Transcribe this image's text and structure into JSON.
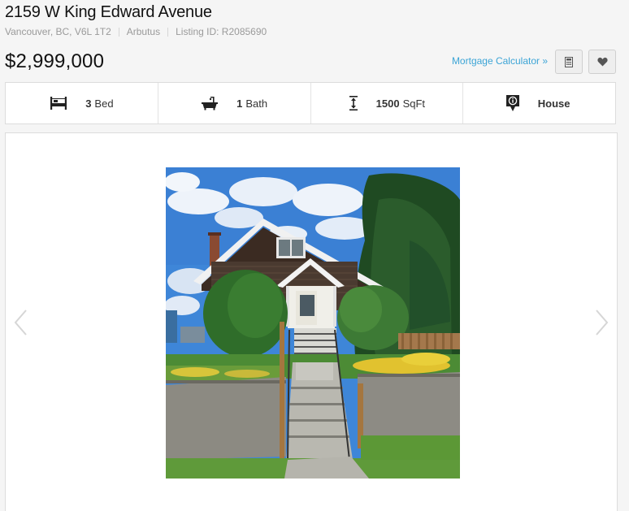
{
  "listing": {
    "title": "2159 W King Edward Avenue",
    "location": "Vancouver, BC, V6L 1T2",
    "neighborhood": "Arbutus",
    "listing_id": "Listing ID: R2085690",
    "price": "$2,999,000"
  },
  "toolbar": {
    "mortgage_label": "Mortgage Calculator »",
    "calculator_icon": "calculator-icon",
    "favorite_icon": "heart-icon"
  },
  "facts": {
    "beds_value": "3",
    "beds_unit": "Bed",
    "baths_value": "1",
    "baths_unit": "Bath",
    "area_value": "1500",
    "area_unit": "SqFt",
    "type_label": "House"
  },
  "gallery": {
    "prev_icon": "chevron-left-icon",
    "next_icon": "chevron-right-icon"
  },
  "colors": {
    "link": "#3ba4d6",
    "background": "#f5f5f5"
  }
}
